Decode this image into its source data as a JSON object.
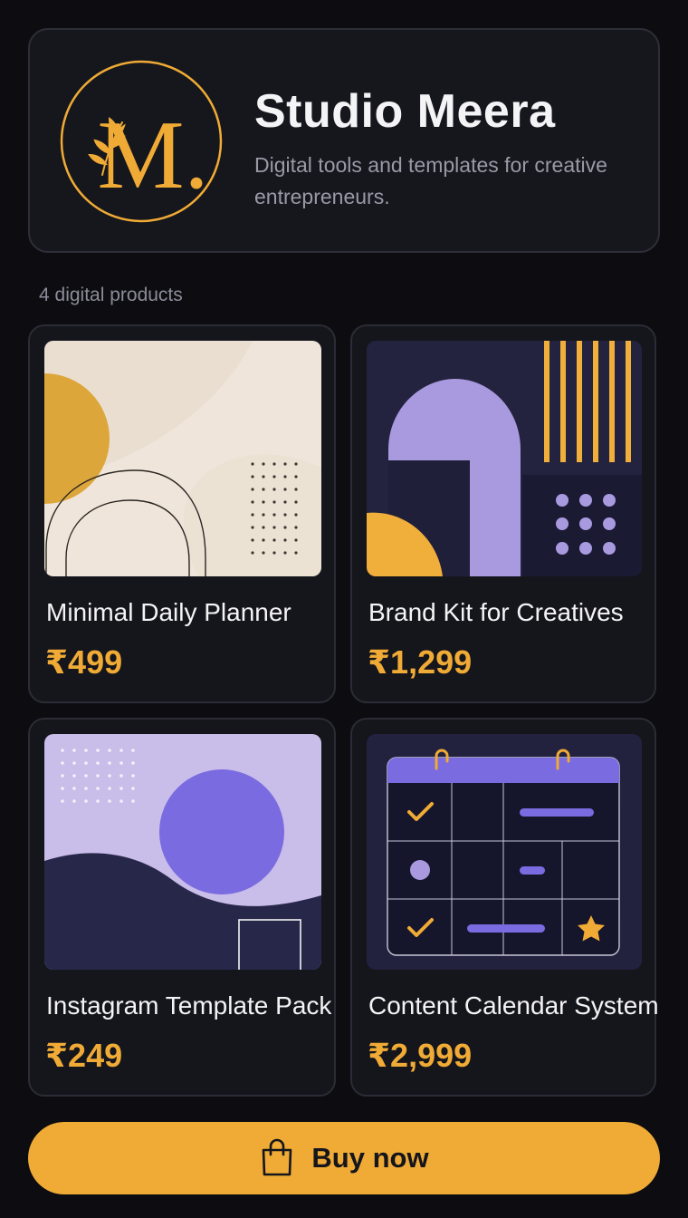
{
  "store": {
    "logo_letter": "M.",
    "name": "Studio Meera",
    "tagline": "Digital tools and templates for creative entrepreneurs."
  },
  "catalog": {
    "count_label": "4 digital products",
    "products": [
      {
        "title": "Minimal Daily Planner",
        "price": "₹499"
      },
      {
        "title": "Brand Kit for Creatives",
        "price": "₹1,299"
      },
      {
        "title": "Instagram Template Pack",
        "price": "₹249"
      },
      {
        "title": "Content Calendar System",
        "price": "₹2,999"
      }
    ]
  },
  "cta": {
    "label": "Buy now",
    "icon": "shopping-bag-icon"
  },
  "colors": {
    "background": "#0c0c11",
    "card": "#16161d",
    "accent": "#efab35",
    "lavender": "#a99adf",
    "navy": "#22223f"
  }
}
